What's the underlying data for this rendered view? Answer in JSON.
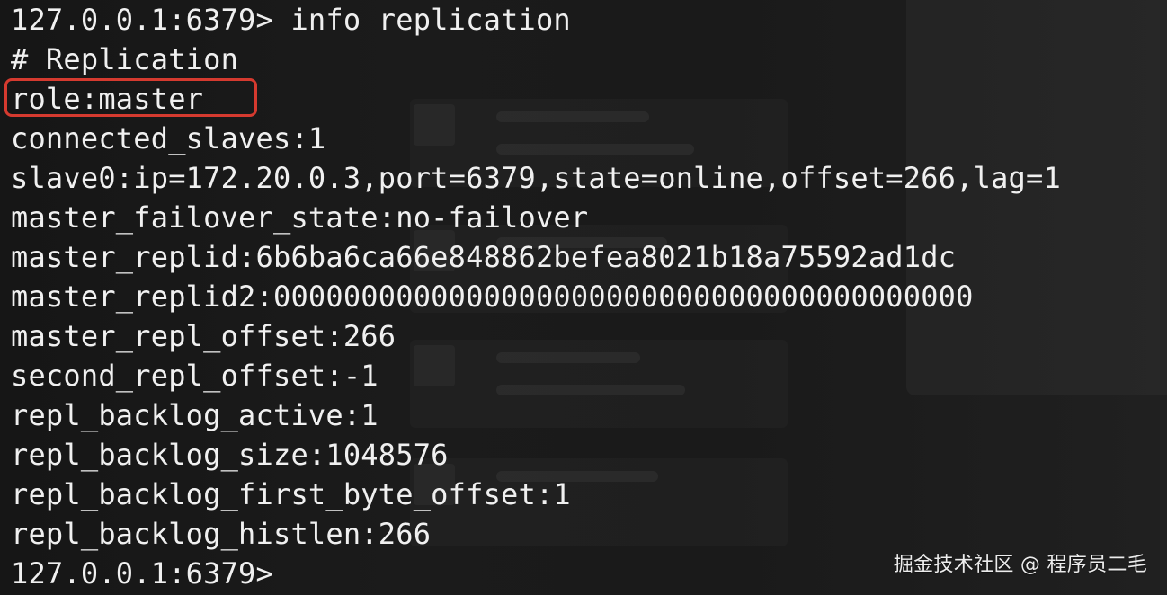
{
  "terminal": {
    "lines": [
      "127.0.0.1:6379> info replication",
      "# Replication",
      "role:master",
      "connected_slaves:1",
      "slave0:ip=172.20.0.3,port=6379,state=online,offset=266,lag=1",
      "master_failover_state:no-failover",
      "master_replid:6b6ba6ca66e848862befea8021b18a75592ad1dc",
      "master_replid2:0000000000000000000000000000000000000000",
      "master_repl_offset:266",
      "second_repl_offset:-1",
      "repl_backlog_active:1",
      "repl_backlog_size:1048576",
      "repl_backlog_first_byte_offset:1",
      "repl_backlog_histlen:266",
      "127.0.0.1:6379>"
    ],
    "highlighted_line_index": 2
  },
  "watermark": {
    "text": "掘金技术社区 @ 程序员二毛"
  },
  "colors": {
    "text": "#f0f0f0",
    "highlight_border": "#d53a2f",
    "background": "#151515"
  }
}
